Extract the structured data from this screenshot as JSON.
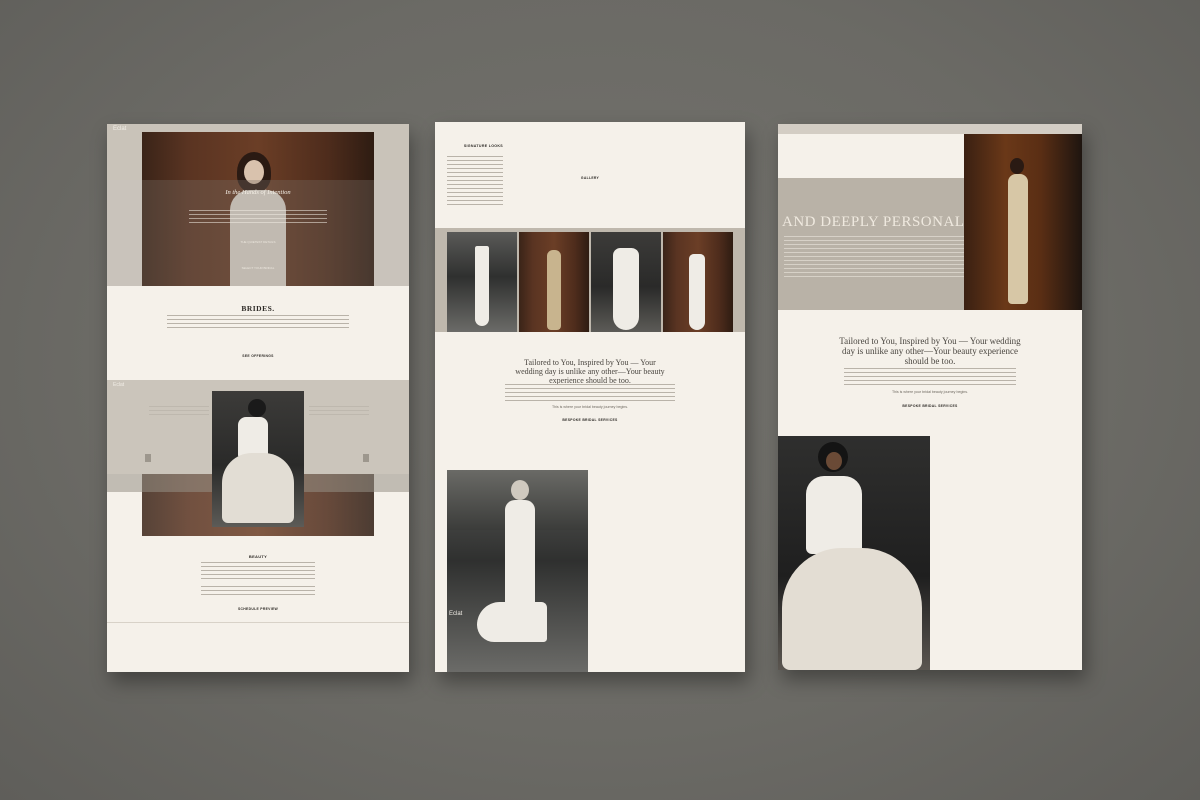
{
  "panel1": {
    "logo": "Eclat",
    "hero_title": "In the Hands of Intention",
    "hero_link": "THE QUIETEST DETAILS",
    "hero_button": "SELECT YOUR BRIDAL",
    "brides_heading": "BRIDES.",
    "brides_button": "SEE OFFERINGS",
    "beauty_heading": "BEAUTY",
    "beauty_button": "SCHEDULE PREVIEW"
  },
  "panel2": {
    "heading": "SIGNATURE LOOKS",
    "gallery_label": "GALLERY",
    "tagline": "Tailored to You, Inspired by You — Your wedding day is unlike any other—Your beauty experience should be too.",
    "closing_line": "This is where your bridal beauty journey begins.",
    "service_button": "BESPOKE BRIDAL SERVICES",
    "footer_logo": "Eclat"
  },
  "panel3": {
    "banner_text": "AND DEEPLY PERSONAL",
    "tagline": "Tailored to You, Inspired by You — Your wedding day is unlike any other—Your beauty experience should be too.",
    "closing_line": "This is where your bridal beauty journey begins.",
    "service_button": "BESPOKE BRIDAL SERVICES"
  },
  "colors": {
    "backdrop": "#6e6d68",
    "page": "#f5f1ea",
    "taupe": "#bfb8ad",
    "door": "#5a3422"
  }
}
